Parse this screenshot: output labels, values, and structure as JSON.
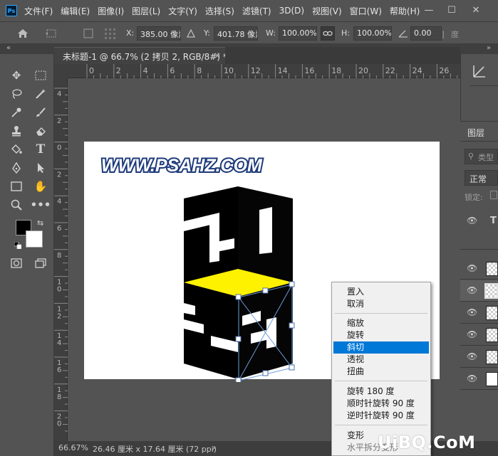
{
  "menu": {
    "items": [
      "文件(F)",
      "编辑(E)",
      "图像(I)",
      "图层(L)",
      "文字(Y)",
      "选择(S)",
      "滤镜(T)",
      "3D(D)",
      "视图(V)",
      "窗口(W)",
      "帮助(H)"
    ]
  },
  "options": {
    "x_label": "X:",
    "x_value": "385.00 像素",
    "y_label": "Y:",
    "y_value": "401.78 像素",
    "w_label": "W:",
    "w_value": "100.00%",
    "h_label": "H:",
    "h_value": "100.00%",
    "angle_value": "0.00",
    "angle_unit": "度"
  },
  "document_tab": {
    "title": "未标题-1 @ 66.7% (2 拷贝 2, RGB/8#) *",
    "close": "×"
  },
  "rulers": {
    "top_ticks": [
      "0",
      "2",
      "4",
      "6",
      "8",
      "10",
      "12",
      "14",
      "16",
      "18",
      "20",
      "22",
      "24",
      "26"
    ],
    "left_ticks": [
      "4",
      "2",
      "0",
      "2",
      "4",
      "6",
      "8",
      "1\n0",
      "1\n2",
      "1\n4",
      "1\n6",
      "1\n8",
      "2\n0"
    ]
  },
  "status": {
    "zoom": "66.67%",
    "doc_size": "26.46 厘米 x 17.64 厘米 (72 ppi)",
    "arrow": "›"
  },
  "layers_panel": {
    "tab_label": "图层",
    "search_placeholder": "类型",
    "blend_mode": "正常",
    "lock_label": "锁定:"
  },
  "artwork": {
    "watermark_text": "WWW.PSAHZ.COM",
    "highlight_color": "#fff200"
  },
  "context_menu": {
    "items": [
      {
        "label": "置入",
        "active": false
      },
      {
        "label": "取消",
        "active": false
      },
      {
        "label": "缩放",
        "active": false
      },
      {
        "label": "旋转",
        "active": false
      },
      {
        "label": "斜切",
        "active": true
      },
      {
        "label": "透视",
        "active": false
      },
      {
        "label": "扭曲",
        "active": false
      },
      {
        "label": "旋转 180 度",
        "active": false
      },
      {
        "label": "顺时针旋转 90 度",
        "active": false
      },
      {
        "label": "逆时针旋转 90 度",
        "active": false
      },
      {
        "label": "变形",
        "active": false
      },
      {
        "label": "水平拆分变形",
        "active": false
      }
    ]
  },
  "site_watermark": "UiBQ.CoM",
  "colors": {
    "accent": "#0078d7",
    "panel": "#535353",
    "dark": "#3d3d3d"
  }
}
